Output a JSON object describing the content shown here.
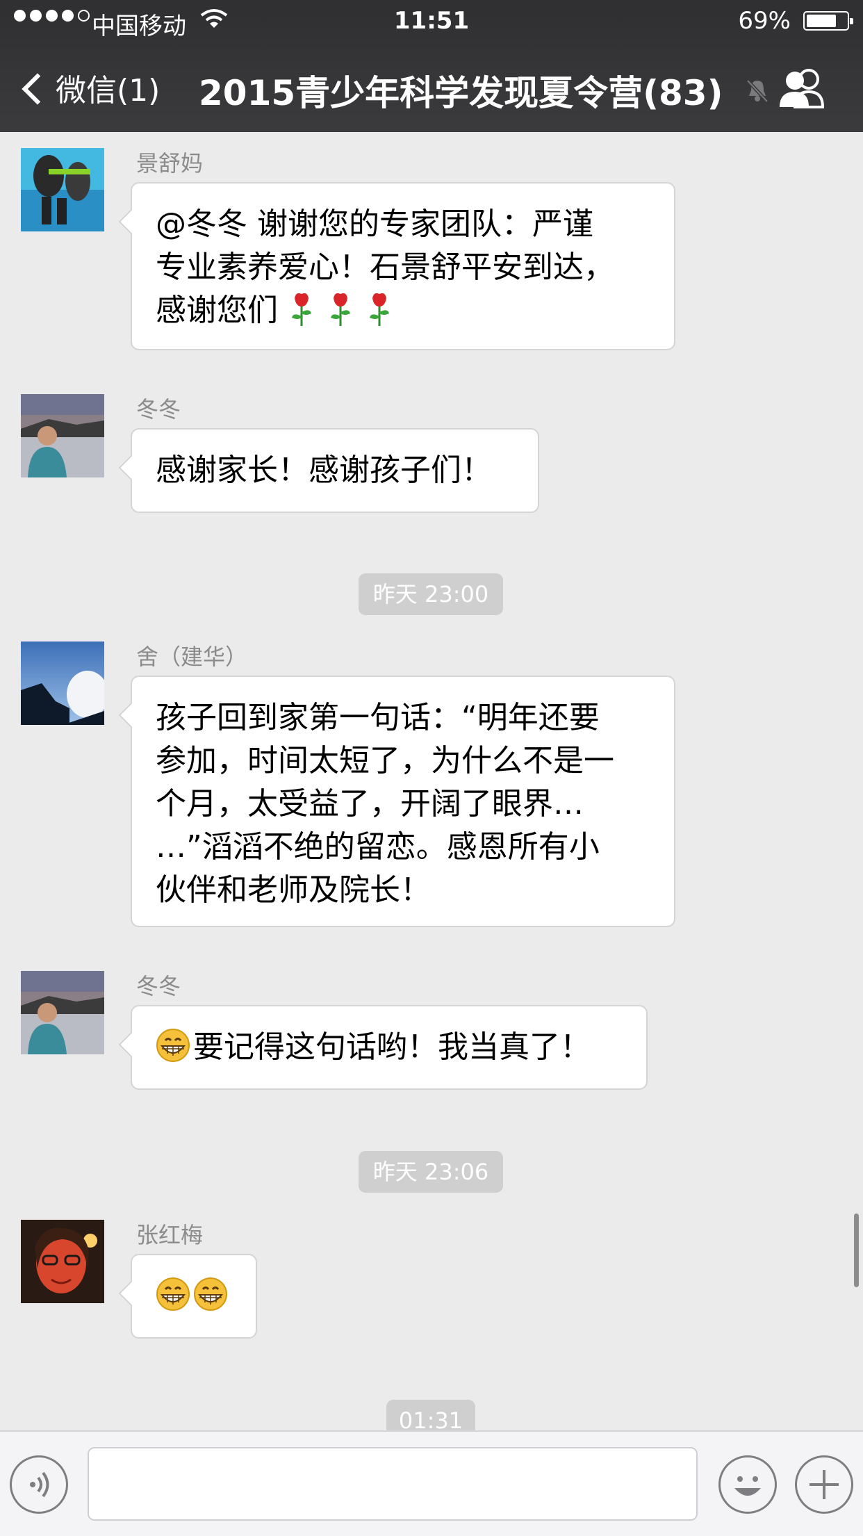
{
  "status_bar": {
    "carrier": "中国移动",
    "time": "11:51",
    "battery": "69%"
  },
  "nav": {
    "back_label": "微信(1)",
    "title": "2015青少年科学发现夏令营(83)"
  },
  "messages": [
    {
      "sender": "景舒妈",
      "lines": [
        "@冬冬 谢谢您的专家团队：严谨",
        "专业素养爱心！石景舒平安到达，",
        "感谢您们"
      ]
    },
    {
      "sender": "冬冬",
      "lines": [
        "感谢家长！感谢孩子们！"
      ]
    },
    {
      "sender": "舍（建华）",
      "lines": [
        "孩子回到家第一句话：“明年还要",
        "参加，时间太短了，为什么不是一",
        "个月，太受益了，开阔了眼界…",
        "…”滔滔不绝的留恋。感恩所有小",
        "伙伴和老师及院长！"
      ]
    },
    {
      "sender": "冬冬",
      "lines": [
        "要记得这句话哟！我当真了！"
      ]
    },
    {
      "sender": "张红梅",
      "lines": [
        ""
      ]
    }
  ],
  "timestamps": [
    "昨天 23:00",
    "昨天 23:06",
    "01:31"
  ],
  "icons": [
    "wifi-icon",
    "chevron-left-icon",
    "mute-bell-icon",
    "group-members-icon",
    "voice-icon",
    "emoji-icon",
    "plus-icon",
    "grinning-emoji-icon",
    "rose-emoji-icon"
  ],
  "colors": {
    "header_bg": "#333335",
    "chat_bg": "#ebebeb",
    "bubble_bg": "#ffffff",
    "timestamp_bg": "#cfcfcf"
  }
}
